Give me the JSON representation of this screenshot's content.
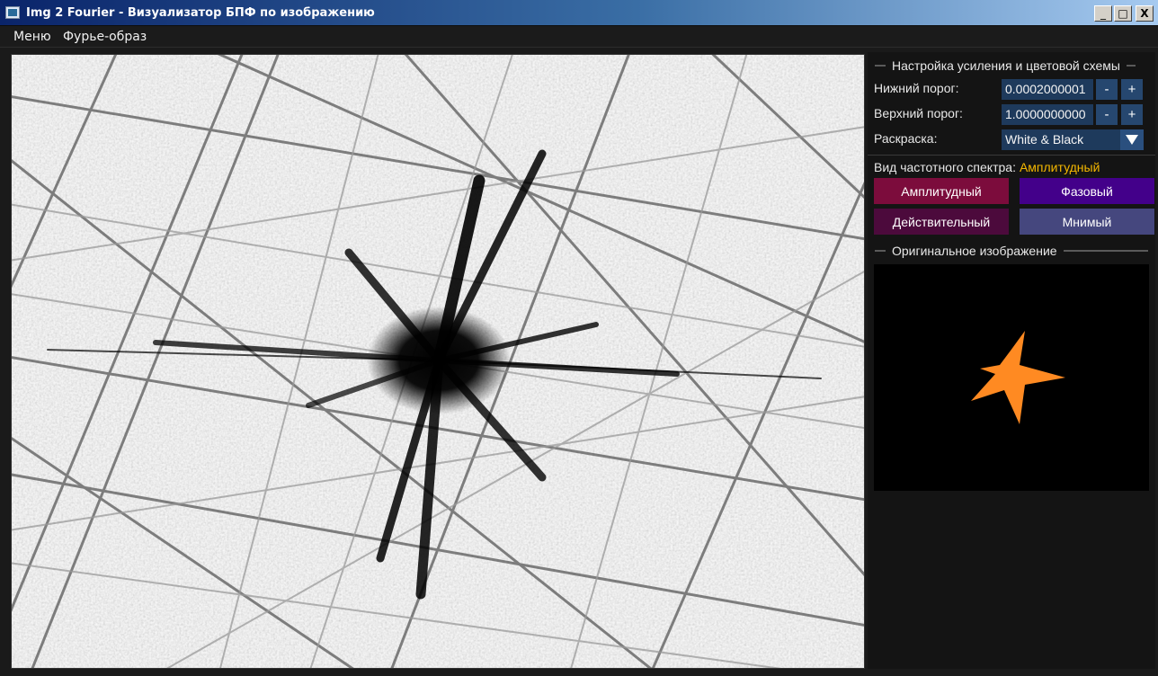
{
  "window": {
    "title": "Img 2 Fourier - Визуализатор БПФ по изображению",
    "minimize_glyph": "_",
    "maximize_glyph": "□",
    "close_glyph": "X"
  },
  "menu": {
    "items": [
      "Меню",
      "Фурье-образ"
    ]
  },
  "gain_section": {
    "title": "Настройка усиления и цветовой схемы",
    "lower_label": "Нижний порог:",
    "lower_value": "0.0002000001",
    "upper_label": "Верхний порог:",
    "upper_value": "1.0000000000",
    "minus": "-",
    "plus": "+",
    "color_label": "Раскраска:",
    "color_value": "White & Black"
  },
  "spectrum": {
    "label": "Вид частотного спектра:",
    "current": "Амплитудный",
    "buttons": {
      "amplitude": "Амплитудный",
      "phase": "Фазовый",
      "real": "Действительный",
      "imaginary": "Мнимый"
    }
  },
  "original_section": {
    "title": "Оригинальное изображение"
  },
  "colors": {
    "accent_yellow": "#f5b800",
    "input_bg": "#1e3a5c",
    "amplitude_btn": "#7c0c3c",
    "phase_btn": "#43008a",
    "real_btn": "#4c0a3c",
    "imaginary_btn": "#45477e",
    "shape_orange": "#ff8a22"
  },
  "icons": {
    "app": "window-app-icon",
    "dropdown": "triangle-down-icon"
  }
}
